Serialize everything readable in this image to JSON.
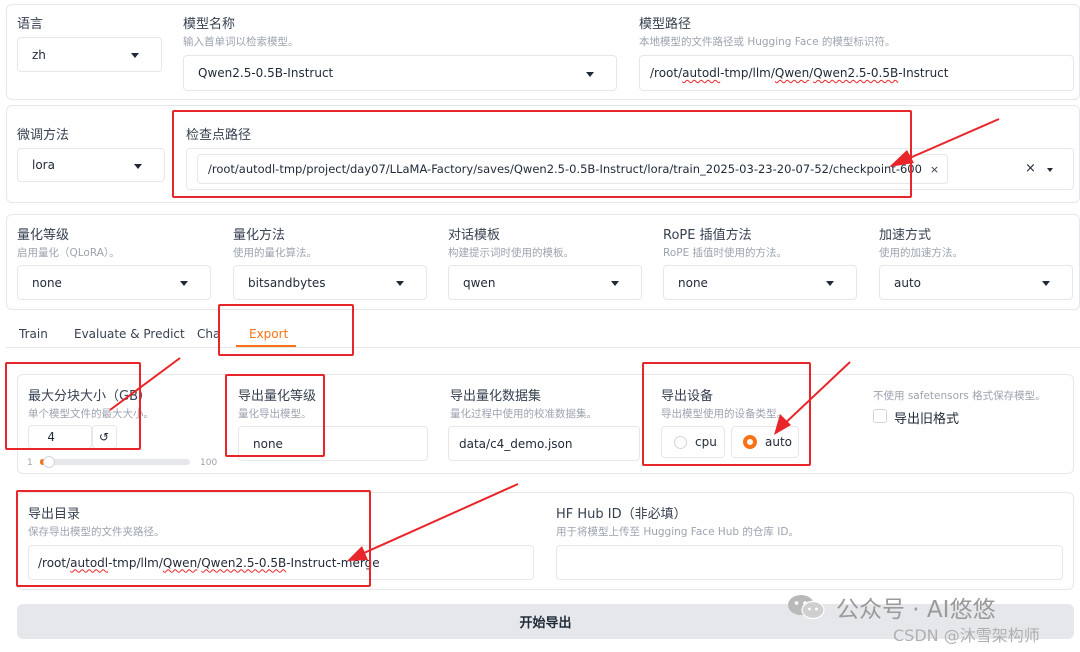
{
  "top_row": {
    "language": {
      "label": "语言",
      "value": "zh"
    },
    "model_name": {
      "label": "模型名称",
      "hint": "输入首单词以检索模型。",
      "value": "Qwen2.5-0.5B-Instruct"
    },
    "model_path": {
      "label": "模型路径",
      "hint": "本地模型的文件路径或 Hugging Face 的模型标识符。",
      "value_prefix": "/root/",
      "value_u1": "autodl",
      "value_mid1": "-tmp/llm/",
      "value_u2": "Qwen",
      "value_mid2": "/",
      "value_u3": "Qwen2.5-0.5B",
      "value_suffix": "-Instruct"
    }
  },
  "second_row": {
    "finetune": {
      "label": "微调方法",
      "value": "lora"
    },
    "checkpoint": {
      "label": "检查点路径",
      "value": "/root/autodl-tmp/project/day07/LLaMA-Factory/saves/Qwen2.5-0.5B-Instruct/lora/train_2025-03-23-20-07-52/checkpoint-600",
      "remove_glyph": "×",
      "clear_glyph": "×"
    }
  },
  "third_row": {
    "quant_bit": {
      "label": "量化等级",
      "hint": "启用量化（QLoRA）。",
      "value": "none"
    },
    "quant_method": {
      "label": "量化方法",
      "hint": "使用的量化算法。",
      "value": "bitsandbytes"
    },
    "template": {
      "label": "对话模板",
      "hint": "构建提示词时使用的模板。",
      "value": "qwen"
    },
    "rope": {
      "label": "RoPE 插值方法",
      "hint": "RoPE 插值时使用的方法。",
      "value": "none"
    },
    "booster": {
      "label": "加速方式",
      "hint": "使用的加速方法。",
      "value": "auto"
    }
  },
  "tabs": [
    {
      "label": "Train"
    },
    {
      "label": "Evaluate & Predict"
    },
    {
      "label": "Chat"
    },
    {
      "label": "Export"
    }
  ],
  "export": {
    "shard_size": {
      "label": "最大分块大小（GB）",
      "hint": "单个模型文件的最大大小。",
      "value": "4",
      "reset_glyph": "↺",
      "min": "1",
      "max": "100",
      "level": 4
    },
    "export_quant": {
      "label": "导出量化等级",
      "hint": "量化导出模型。",
      "value": "none"
    },
    "quant_dataset": {
      "label": "导出量化数据集",
      "hint": "量化过程中使用的校准数据集。",
      "value": "data/c4_demo.json"
    },
    "device": {
      "label": "导出设备",
      "hint": "导出模型使用的设备类型。",
      "options": [
        "cpu",
        "auto"
      ],
      "selected": "auto"
    },
    "legacy": {
      "hint": "不使用 safetensors 格式保存模型。",
      "label": "导出旧格式"
    },
    "export_dir": {
      "label": "导出目录",
      "hint": "保存导出模型的文件夹路径。",
      "value_prefix": "/root/",
      "value_u1": "autodl",
      "value_mid1": "-tmp/llm/",
      "value_u2": "Qwen",
      "value_mid2": "/",
      "value_u3": "Qwen2.5-0.5B",
      "value_suffix": "-Instruct-merge"
    },
    "hub_id": {
      "label": "HF Hub ID（非必填）",
      "hint": "用于将模型上传至 Hugging Face Hub 的仓库 ID。",
      "value": ""
    },
    "start_button": "开始导出"
  },
  "watermark": {
    "line1": "公众号 · AI悠悠",
    "line2": "CSDN @沐雪架构师"
  },
  "colors": {
    "accent": "#f97316",
    "annotation": "#e8262a"
  }
}
